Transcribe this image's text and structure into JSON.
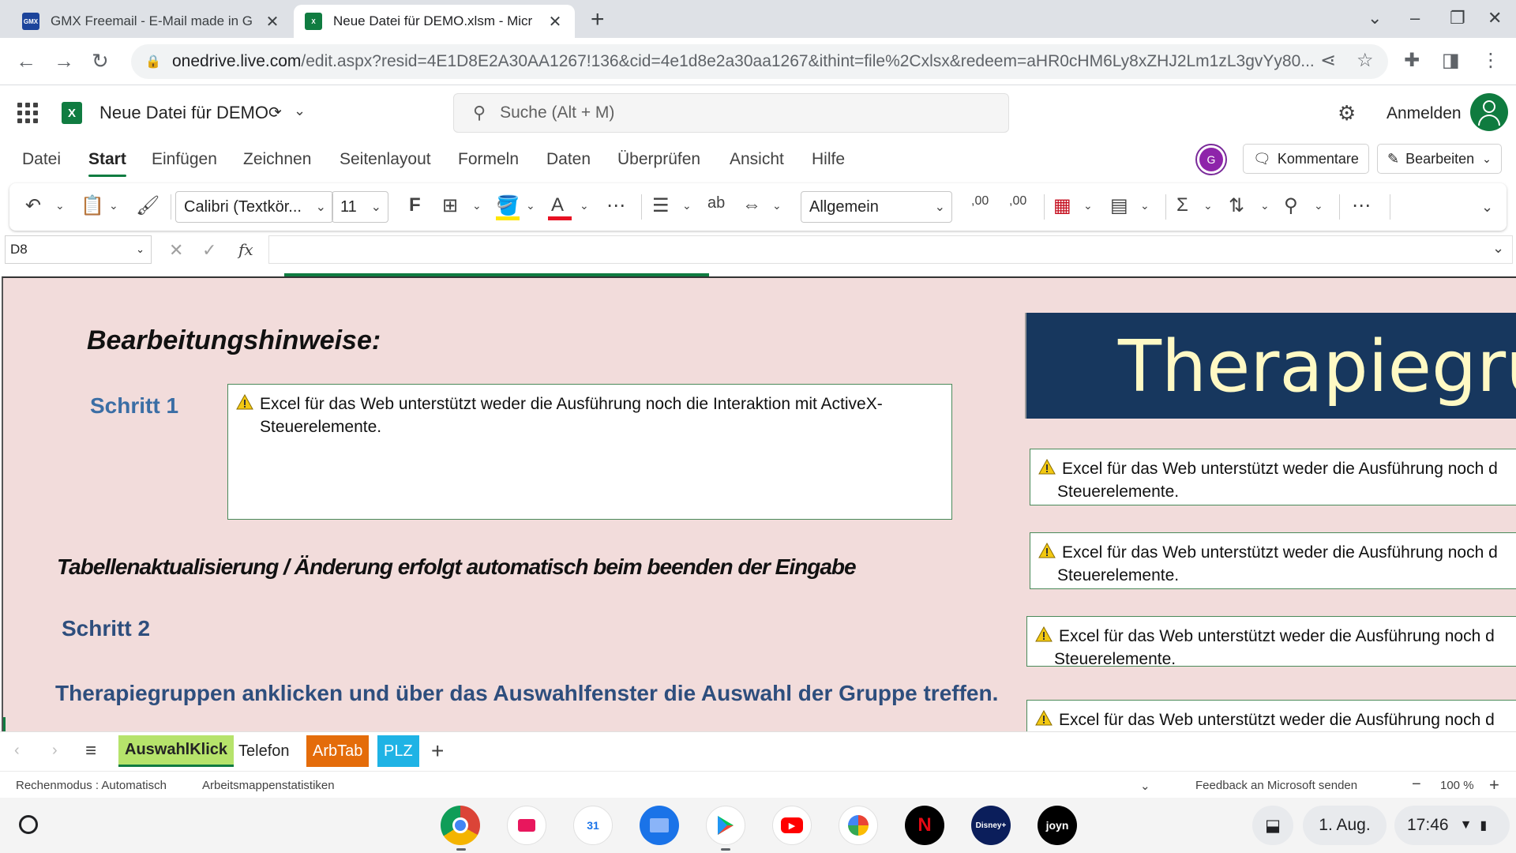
{
  "browser": {
    "tabs": [
      {
        "title": "GMX Freemail - E-Mail made in G",
        "favicon": "gmx-icon",
        "active": false
      },
      {
        "title": "Neue Datei für DEMO.xlsm - Micr",
        "favicon": "excel-icon",
        "active": true
      }
    ],
    "url_host": "onedrive.live.com",
    "url_path": "/edit.aspx?resid=4E1D8E2A30AA1267!136&cid=4e1d8e2a30aa1267&ithint=file%2Cxlsx&redeem=aHR0cHM6Ly8xZHJ2Lm1zL3gvYy80..."
  },
  "app": {
    "favicon_letter": "X",
    "gmx_label": "GMX",
    "doc_title": "Neue Datei für DEMO",
    "search_placeholder": "Suche (Alt + M)",
    "sign_in": "Anmelden"
  },
  "ribbon": {
    "tabs": [
      "Datei",
      "Start",
      "Einfügen",
      "Zeichnen",
      "Seitenlayout",
      "Formeln",
      "Daten",
      "Überprüfen",
      "Ansicht",
      "Hilfe"
    ],
    "active_tab": "Start",
    "user_initial": "G",
    "comments_label": "Kommentare",
    "edit_label": "Bearbeiten"
  },
  "toolbar": {
    "font_name": "Calibri (Textkör...",
    "font_size": "11",
    "bold_label": "F",
    "number_format": "Allgemein",
    "wrap_label": "ab",
    "inc_decimal": ",00",
    "dec_decimal": ",00",
    "font_color_letter": "A",
    "highlight_color": "#ffe600",
    "font_color": "#e81123"
  },
  "formula_bar": {
    "cell_ref": "D8",
    "fx_label": "fx",
    "value": ""
  },
  "sheet": {
    "heading": "Bearbeitungshinweise:",
    "step1": "Schritt 1",
    "step2": "Schritt 2",
    "auto_update": "Tabellenaktualisierung / Änderung erfolgt  automatisch beim beenden der Eingabe",
    "instruction": "Therapiegruppen anklicken und über das Auswahlfenster die Auswahl der Gruppe treffen.",
    "banner": "Therapiegrup",
    "activex_message": "Excel für das Web unterstützt weder die Ausführung noch die Interaktion mit ActiveX-Steuerelemente.",
    "activex_line1": "Excel für das Web unterstützt weder die Ausführung noch d",
    "activex_line2": "Steuerelemente.",
    "background": "#f2dcdb",
    "banner_background": "#17375e"
  },
  "sheet_tabs": [
    {
      "label": "AuswahlKlick",
      "active": true,
      "color": "#b6e36b"
    },
    {
      "label": "Telefon",
      "active": false,
      "color": ""
    },
    {
      "label": "ArbTab",
      "active": false,
      "color": "#e46c0a"
    },
    {
      "label": "PLZ",
      "active": false,
      "color": "#1fb3e5"
    }
  ],
  "status_bar": {
    "calc_mode": "Rechenmodus : Automatisch",
    "stats": "Arbeitsmappenstatistiken",
    "feedback": "Feedback an Microsoft senden",
    "zoom": "100 %"
  },
  "shelf": {
    "apps": [
      "chrome-icon",
      "gmail-icon",
      "calendar-icon",
      "files-icon",
      "play-store-icon",
      "youtube-icon",
      "photos-icon",
      "netflix-icon",
      "disney-plus-icon",
      "joyn-icon"
    ],
    "calendar_day": "31",
    "netflix_letter": "N",
    "disney_label": "Disney+",
    "joyn_label": "joyn",
    "date": "1. Aug.",
    "time": "17:46"
  }
}
